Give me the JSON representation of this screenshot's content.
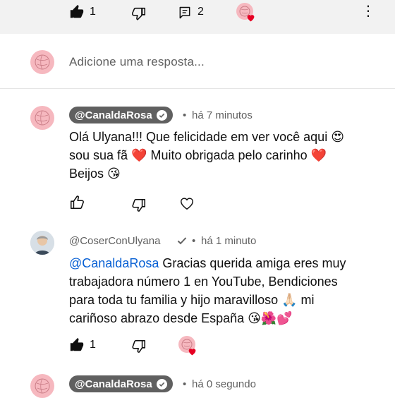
{
  "top_actions": {
    "like_count": "1",
    "reply_count": "2",
    "more_symbol": "⋮"
  },
  "reply_box": {
    "placeholder": "Adicione uma resposta..."
  },
  "comments": [
    {
      "author": "@CanaldaRosa",
      "time": "há 7 minutos",
      "line1": "Olá Ulyana!!! Que felicidade em ver você aqui 😍",
      "line2": "sou sua fã ❤️ Muito obrigada pelo carinho ❤️",
      "line3": "Beijos 😘",
      "likes": ""
    },
    {
      "author": "@CoserConUlyana",
      "time": "há 1 minuto",
      "mention": "@CanaldaRosa",
      "line1_rest": " Gracias querida amiga eres muy",
      "line2": "trabajadora número 1 en YouTube, Bendiciones",
      "line3": "para toda tu familia y hijo maravilloso 🙏🏻 mi",
      "line4": "cariñoso abrazo desde España 😘🌺💕",
      "likes": "1"
    },
    {
      "author": "@CanaldaRosa",
      "time": "há 0 segundo"
    }
  ],
  "separator_dot": "•",
  "colors": {
    "avatar_pink": "#f6b8bf",
    "pill_gray": "#606060",
    "mention_blue": "#065fd4",
    "heart_red": "#e60023"
  }
}
